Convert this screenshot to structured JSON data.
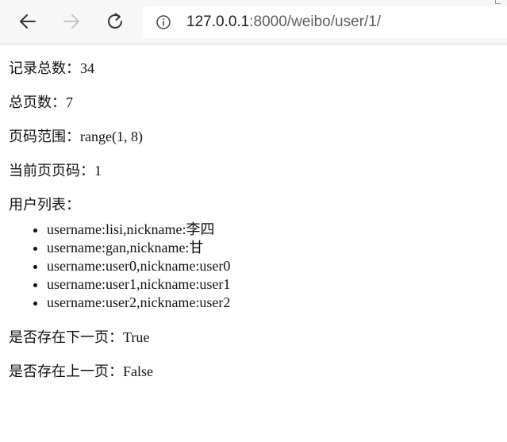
{
  "browser": {
    "url_host": "127.0.0.1",
    "url_rest": ":8000/weibo/user/1/",
    "icons": {
      "back": "arrow-left-icon",
      "forward": "arrow-right-icon",
      "reload": "reload-icon",
      "site_info": "info-circle-icon"
    }
  },
  "page": {
    "total_records": "记录总数：34",
    "total_pages": "总页数：7",
    "page_range": "页码范围：range(1, 8)",
    "current_page": "当前页页码：1",
    "user_list_label": "用户列表：",
    "users": [
      "username:lisi,nickname:李四",
      "username:gan,nickname:甘",
      "username:user0,nickname:user0",
      "username:user1,nickname:user1",
      "username:user2,nickname:user2"
    ],
    "has_next": "是否存在下一页：True",
    "has_previous": "是否存在上一页：False"
  }
}
